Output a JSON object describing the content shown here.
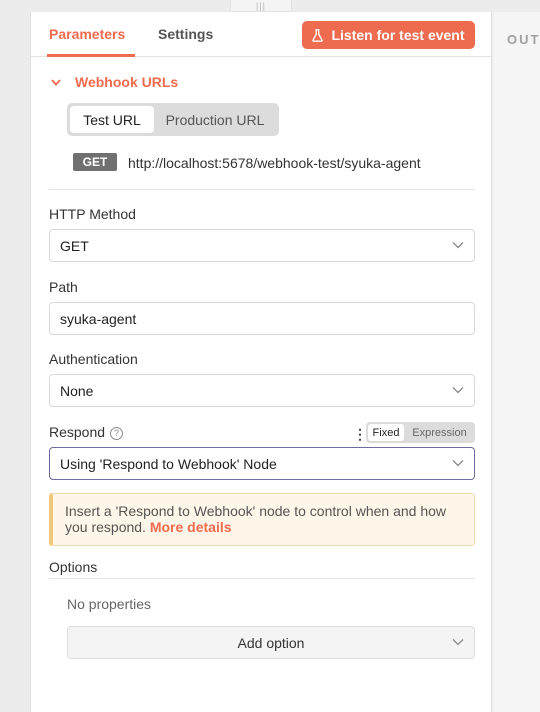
{
  "tabs": {
    "parameters": "Parameters",
    "settings": "Settings"
  },
  "listen_button": "Listen for test event",
  "drag_handle": "|||",
  "output_label": "OUT",
  "webhook": {
    "title": "Webhook URLs",
    "url_toggle": {
      "test": "Test URL",
      "production": "Production URL",
      "selected": "Test URL"
    },
    "method": "GET",
    "url": "http://localhost:5678/webhook-test/syuka-agent"
  },
  "http_method": {
    "label": "HTTP Method",
    "value": "GET"
  },
  "path": {
    "label": "Path",
    "value": "syuka-agent"
  },
  "authentication": {
    "label": "Authentication",
    "value": "None"
  },
  "respond": {
    "label": "Respond",
    "help": "?",
    "kebab": "⋮",
    "mode_fixed": "Fixed",
    "mode_expression": "Expression",
    "mode_selected": "Fixed",
    "value": "Using 'Respond to Webhook' Node"
  },
  "notice": {
    "text": "Insert a 'Respond to Webhook' node to control when and how you respond.",
    "link": "More details"
  },
  "options": {
    "label": "Options",
    "empty": "No properties",
    "add_button": "Add option"
  },
  "colors": {
    "accent": "#ef6b4f",
    "badge": "#707070",
    "notice_bg": "#fdf6e9",
    "focus_border": "#6d6a9c"
  }
}
